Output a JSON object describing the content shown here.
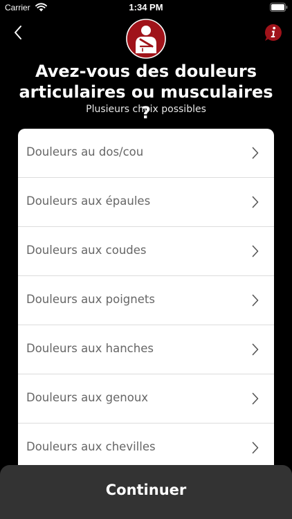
{
  "status_bar": {
    "carrier": "Carrier",
    "time": "1:34 PM",
    "icons": [
      "wifi-icon",
      "battery-icon"
    ]
  },
  "header": {
    "back_icon": "chevron-left-icon",
    "avatar_icon": "injured-arm-sling-icon",
    "info_icon": "info-icon",
    "accent_color": "#a0131a",
    "title": "Avez-vous des douleurs articulaires ou musculaires ?",
    "subtitle": "Plusieurs choix possibles"
  },
  "options": [
    {
      "label": "Douleurs au dos/cou"
    },
    {
      "label": "Douleurs aux épaules"
    },
    {
      "label": "Douleurs aux coudes"
    },
    {
      "label": "Douleurs aux poignets"
    },
    {
      "label": "Douleurs aux hanches"
    },
    {
      "label": "Douleurs aux genoux"
    },
    {
      "label": "Douleurs aux chevilles"
    }
  ],
  "footer": {
    "continue_label": "Continuer"
  },
  "colors": {
    "background": "#000000",
    "card": "#ffffff",
    "option_text": "#666666",
    "footer_bar": "#333333"
  }
}
